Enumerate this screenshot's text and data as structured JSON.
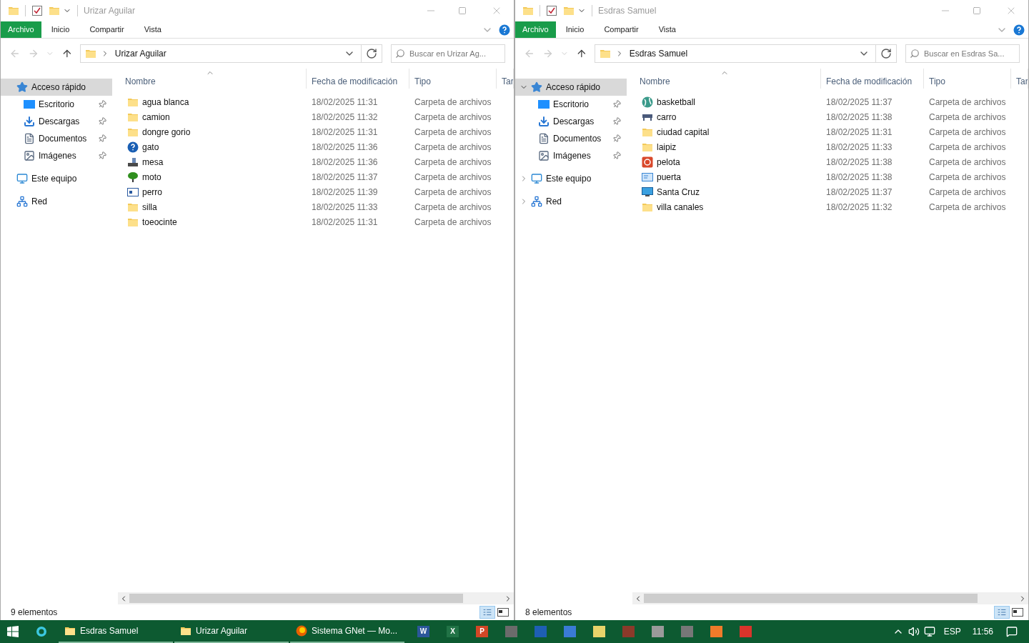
{
  "windows": [
    {
      "title": "Urizar Aguilar",
      "ribbon_tabs": [
        {
          "label": "Archivo",
          "kind": "file"
        },
        {
          "label": "Inicio",
          "kind": "tab"
        },
        {
          "label": "Compartir",
          "kind": "tab"
        },
        {
          "label": "Vista",
          "kind": "tab"
        }
      ],
      "address": "Urizar Aguilar",
      "search_placeholder": "Buscar en Urizar Ag...",
      "nav": [
        {
          "label": "Acceso rápido",
          "kind": "star",
          "selected": true,
          "children": [
            {
              "label": "Escritorio",
              "kind": "desktop",
              "pinned": true,
              "selected": false
            },
            {
              "label": "Descargas",
              "kind": "download",
              "pinned": true,
              "selected": false
            },
            {
              "label": "Documentos",
              "kind": "document",
              "pinned": true,
              "selected": false
            },
            {
              "label": "Imágenes",
              "kind": "pictures",
              "pinned": true,
              "selected": false
            }
          ]
        },
        {
          "label": "Este equipo",
          "kind": "computer",
          "selected": false
        },
        {
          "label": "Red",
          "kind": "network",
          "selected": false
        }
      ],
      "columns": [
        {
          "label": "Nombre",
          "sorted": true
        },
        {
          "label": "Fecha de modificación",
          "sorted": false
        },
        {
          "label": "Tipo",
          "sorted": false
        },
        {
          "label": "Tar",
          "sorted": false
        }
      ],
      "rows": [
        {
          "name": "agua blanca",
          "kind": "folder",
          "date": "18/02/2025 11:31",
          "type": "Carpeta de archivos"
        },
        {
          "name": "camion",
          "kind": "folder",
          "date": "18/02/2025 11:32",
          "type": "Carpeta de archivos"
        },
        {
          "name": "dongre gorio",
          "kind": "folder",
          "date": "18/02/2025 11:31",
          "type": "Carpeta de archivos"
        },
        {
          "name": "gato",
          "kind": "help",
          "date": "18/02/2025 11:36",
          "type": "Carpeta de archivos"
        },
        {
          "name": "mesa",
          "kind": "printer",
          "date": "18/02/2025 11:36",
          "type": "Carpeta de archivos"
        },
        {
          "name": "moto",
          "kind": "tree",
          "date": "18/02/2025 11:37",
          "type": "Carpeta de archivos"
        },
        {
          "name": "perro",
          "kind": "window",
          "date": "18/02/2025 11:39",
          "type": "Carpeta de archivos"
        },
        {
          "name": "silla",
          "kind": "folder",
          "date": "18/02/2025 11:33",
          "type": "Carpeta de archivos"
        },
        {
          "name": "toeocinte",
          "kind": "folder",
          "date": "18/02/2025 11:31",
          "type": "Carpeta de archivos"
        }
      ],
      "status": "9 elementos"
    },
    {
      "title": "Esdras Samuel",
      "ribbon_tabs": [
        {
          "label": "Archivo",
          "kind": "file"
        },
        {
          "label": "Inicio",
          "kind": "tab"
        },
        {
          "label": "Compartir",
          "kind": "tab"
        },
        {
          "label": "Vista",
          "kind": "tab"
        }
      ],
      "address": "Esdras Samuel",
      "search_placeholder": "Buscar en Esdras Sa...",
      "nav": [
        {
          "label": "Acceso rápido",
          "kind": "star",
          "selected": true,
          "expanded": true,
          "children": [
            {
              "label": "Escritorio",
              "kind": "desktop",
              "pinned": true,
              "selected": false
            },
            {
              "label": "Descargas",
              "kind": "download",
              "pinned": true,
              "selected": false
            },
            {
              "label": "Documentos",
              "kind": "document",
              "pinned": true,
              "selected": false
            },
            {
              "label": "Imágenes",
              "kind": "pictures",
              "pinned": true,
              "selected": false
            }
          ]
        },
        {
          "label": "Este equipo",
          "kind": "computer",
          "selected": false,
          "expanded": false
        },
        {
          "label": "Red",
          "kind": "network",
          "selected": false,
          "expanded": false
        }
      ],
      "columns": [
        {
          "label": "Nombre",
          "sorted": true
        },
        {
          "label": "Fecha de modificación",
          "sorted": false
        },
        {
          "label": "Tipo",
          "sorted": false
        },
        {
          "label": "Tar",
          "sorted": false
        }
      ],
      "rows": [
        {
          "name": "basketball",
          "kind": "globe",
          "date": "18/02/2025 11:37",
          "type": "Carpeta de archivos"
        },
        {
          "name": "carro",
          "kind": "scanner",
          "date": "18/02/2025 11:38",
          "type": "Carpeta de archivos"
        },
        {
          "name": "ciudad capital",
          "kind": "folder",
          "date": "18/02/2025 11:31",
          "type": "Carpeta de archivos"
        },
        {
          "name": "laipiz",
          "kind": "folder",
          "date": "18/02/2025 11:33",
          "type": "Carpeta de archivos"
        },
        {
          "name": "pelota",
          "kind": "power",
          "date": "18/02/2025 11:38",
          "type": "Carpeta de archivos"
        },
        {
          "name": "puerta",
          "kind": "card",
          "date": "18/02/2025 11:38",
          "type": "Carpeta de archivos"
        },
        {
          "name": "Santa Cruz",
          "kind": "monitor",
          "date": "18/02/2025 11:37",
          "type": "Carpeta de archivos"
        },
        {
          "name": "villa canales",
          "kind": "folder",
          "date": "18/02/2025 11:32",
          "type": "Carpeta de archivos"
        }
      ],
      "status": "8 elementos"
    }
  ],
  "taskbar": {
    "windows": [
      {
        "label": "Esdras Samuel",
        "kind": "folder"
      },
      {
        "label": "Urizar Aguilar",
        "kind": "folder"
      },
      {
        "label": "Sistema GNet — Mo...",
        "kind": "browser"
      }
    ],
    "apps": [
      {
        "glyph": "W",
        "color": "#2b579a"
      },
      {
        "glyph": "X",
        "color": "#217346"
      },
      {
        "glyph": "P",
        "color": "#d24726"
      },
      {
        "color": "#6b6b6b"
      },
      {
        "color": "#1e5fb4"
      },
      {
        "color": "#3a7bd5"
      },
      {
        "color": "#e8d36a"
      },
      {
        "color": "#8b3a2a"
      },
      {
        "color": "#9a9a9a"
      },
      {
        "color": "#777777"
      },
      {
        "color": "#f07b2a"
      },
      {
        "color": "#d9342b"
      }
    ],
    "language": "ESP",
    "time": "11:56"
  }
}
